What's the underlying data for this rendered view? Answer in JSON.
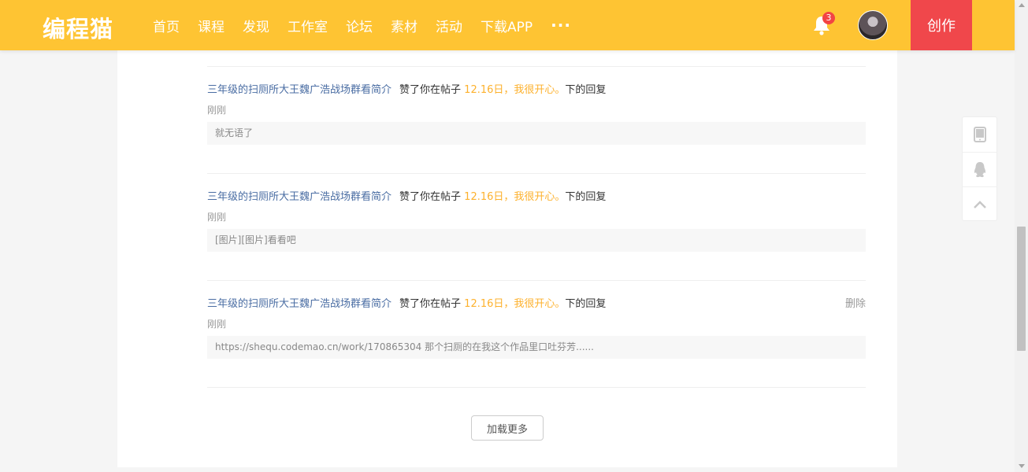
{
  "app": {
    "logo": "编程猫",
    "nav": [
      "首页",
      "课程",
      "发现",
      "工作室",
      "论坛",
      "素材",
      "活动",
      "下载APP"
    ],
    "more": "···",
    "notification_count": "3",
    "create_label": "创作"
  },
  "notifications": [
    {
      "user": "三年级的扫厕所大王魏广浩战场群看简介",
      "action": "赞了你在帖子",
      "post": "12.16日，我很开心。",
      "suffix": "下的回复",
      "time": "刚刚",
      "quote": "就无语了",
      "delete_label": ""
    },
    {
      "user": "三年级的扫厕所大王魏广浩战场群看简介",
      "action": "赞了你在帖子",
      "post": "12.16日，我很开心。",
      "suffix": "下的回复",
      "time": "刚刚",
      "quote": "[图片][图片]看看吧",
      "delete_label": ""
    },
    {
      "user": "三年级的扫厕所大王魏广浩战场群看简介",
      "action": "赞了你在帖子",
      "post": "12.16日，我很开心。",
      "suffix": "下的回复",
      "time": "刚刚",
      "quote": "https://shequ.codemao.cn/work/170865304 那个扫厕的在我这个作品里口吐芬芳......",
      "delete_label": "删除"
    }
  ],
  "load_more": "加载更多",
  "side_tools": {
    "icons": [
      "tablet-icon",
      "qq-icon",
      "back-to-top-icon"
    ]
  },
  "colors": {
    "brand": "#fec433",
    "create": "#f0474b",
    "user_link": "#4a6da3",
    "post_link": "#fdb12d",
    "badge": "#f24444"
  }
}
